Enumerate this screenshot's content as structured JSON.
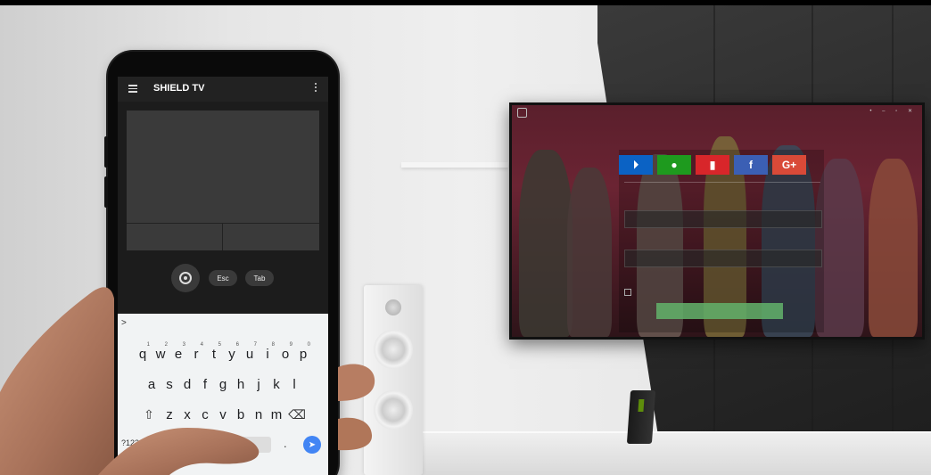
{
  "phone": {
    "app_title": "SHIELD TV",
    "buttons": {
      "esc": "Esc",
      "tab": "Tab"
    },
    "keyboard": {
      "prompt": ">",
      "row1": [
        {
          "key": "q",
          "hint": "1"
        },
        {
          "key": "w",
          "hint": "2"
        },
        {
          "key": "e",
          "hint": "3"
        },
        {
          "key": "r",
          "hint": "4"
        },
        {
          "key": "t",
          "hint": "5"
        },
        {
          "key": "y",
          "hint": "6"
        },
        {
          "key": "u",
          "hint": "7"
        },
        {
          "key": "i",
          "hint": "8"
        },
        {
          "key": "o",
          "hint": "9"
        },
        {
          "key": "p",
          "hint": "0"
        }
      ],
      "row2": [
        "a",
        "s",
        "d",
        "f",
        "g",
        "h",
        "j",
        "k",
        "l"
      ],
      "row3": [
        "z",
        "x",
        "c",
        "v",
        "b",
        "n",
        "m"
      ],
      "shift_icon": "⇧",
      "backspace_icon": "⌫",
      "symbols_key": "?123",
      "at_key": "@",
      "period_key": ".",
      "send_icon": "➤"
    }
  },
  "tv": {
    "social_buttons": [
      {
        "name": "playstation",
        "color": "#0b62c4",
        "glyph": "⏵"
      },
      {
        "name": "xbox",
        "color": "#1e9a1e",
        "glyph": "●"
      },
      {
        "name": "nintendo",
        "color": "#d8262a",
        "glyph": "▮"
      },
      {
        "name": "facebook",
        "color": "#3b5fb4",
        "glyph": "f"
      },
      {
        "name": "google-plus",
        "color": "#d94a38",
        "glyph": "G+"
      }
    ]
  },
  "colors": {
    "shield_green": "#76b900",
    "send_blue": "#4285f4",
    "signin_green": "#63b36b"
  }
}
